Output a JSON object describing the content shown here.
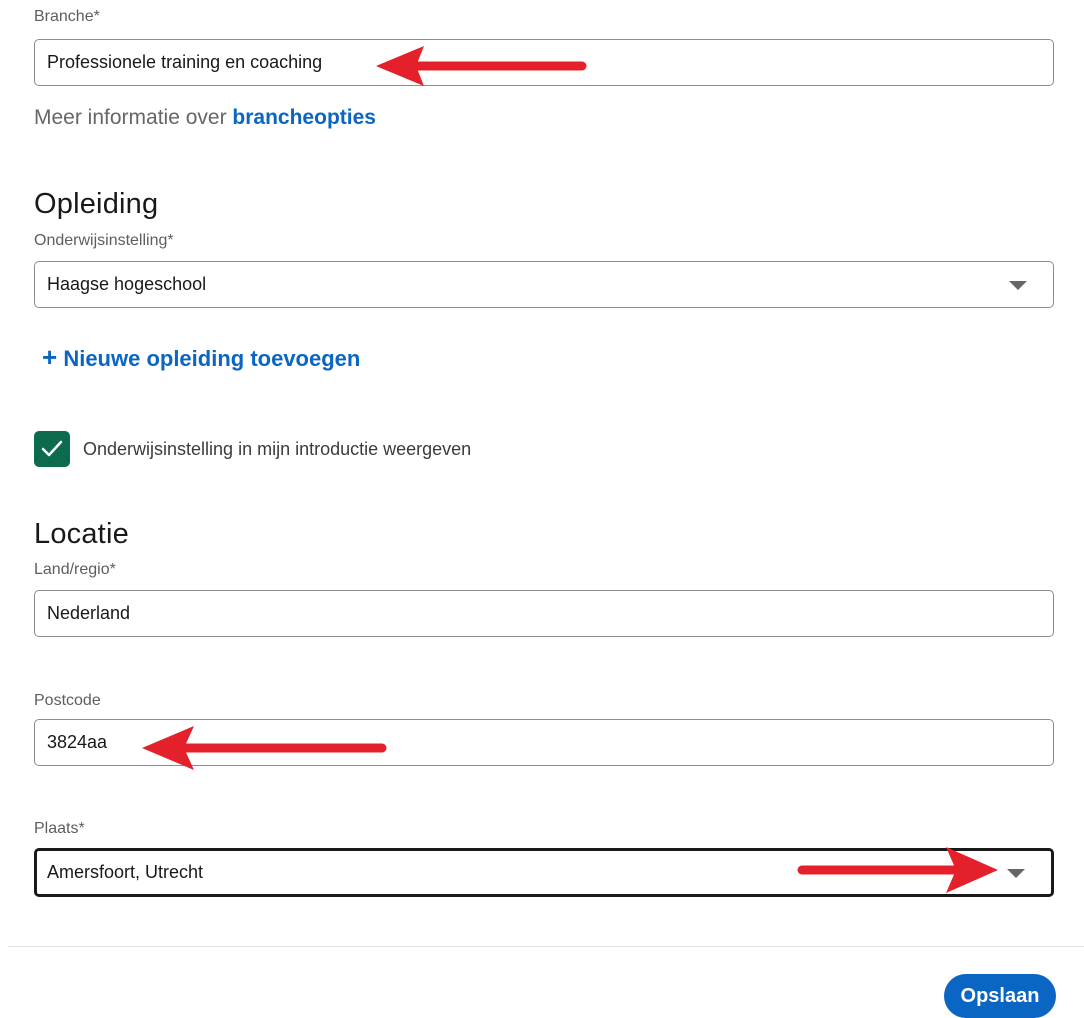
{
  "industry": {
    "label": "Branche*",
    "value": "Professionele training en coaching",
    "info_prefix": "Meer informatie over",
    "info_link": "brancheopties"
  },
  "education": {
    "title": "Opleiding",
    "school_label": "Onderwijsinstelling*",
    "school_value": "Haagse hogeschool",
    "add_plus": "+",
    "add_label": "Nieuwe opleiding toevoegen",
    "show_in_intro_checked": true,
    "show_in_intro_label": "Onderwijsinstelling in mijn introductie weergeven"
  },
  "location": {
    "title": "Locatie",
    "country_label": "Land/regio*",
    "country_value": "Nederland",
    "postal_label": "Postcode",
    "postal_value": "3824aa",
    "city_label": "Plaats*",
    "city_value": "Amersfoort, Utrecht"
  },
  "footer": {
    "save_label": "Opslaan"
  },
  "colors": {
    "link": "#0a66c2",
    "checkbox": "#0c6b4f",
    "annotation_arrow": "#e4202a"
  },
  "icons": {
    "dropdown": "chevron-down-icon",
    "check": "check-icon",
    "annotation": "red-arrow-icon"
  }
}
